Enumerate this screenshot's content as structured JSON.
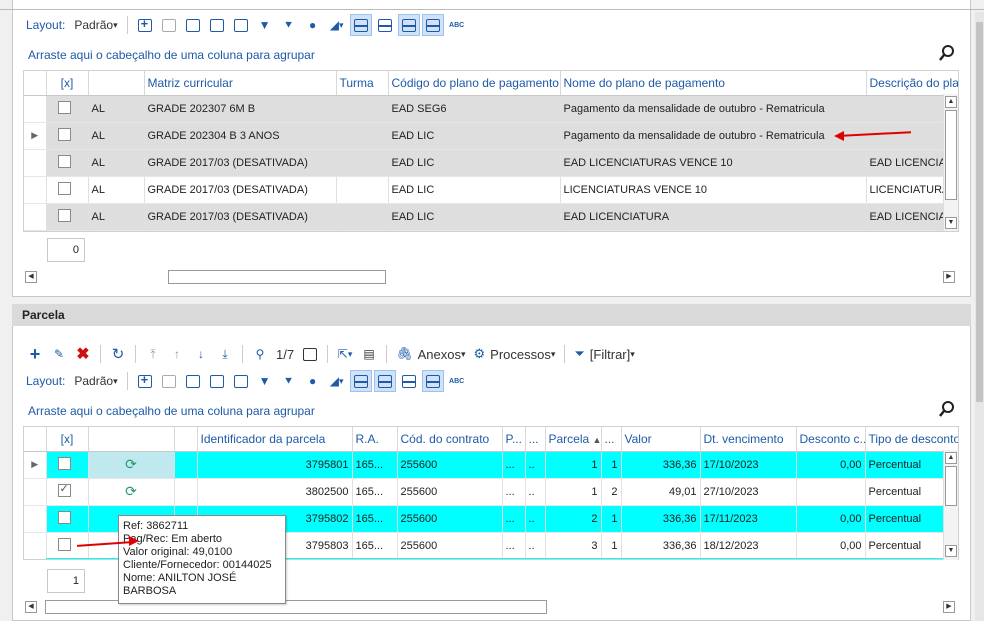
{
  "top_toolbar": {
    "layout_label": "Layout:",
    "layout_value": "Padrão",
    "abc_label": "ABC"
  },
  "top_grid": {
    "group_hint": "Arraste aqui o cabeçalho de uma coluna para agrupar",
    "columns": [
      "[x]",
      "",
      "Matriz curricular",
      "Turma",
      "Código do plano de pagamento",
      "Nome do plano de pagamento",
      "Descrição do plano"
    ],
    "rows": [
      {
        "c1": "AL",
        "matriz": "GRADE 202307 6M B",
        "turma": "",
        "codigo": "EAD SEG6",
        "nome": "Pagamento da mensalidade de outubro - Rematricula",
        "descricao": ""
      },
      {
        "c1": "AL",
        "matriz": "GRADE 202304 B 3 ANOS",
        "turma": "",
        "codigo": "EAD LIC",
        "nome": "Pagamento da mensalidade de outubro - Rematricula",
        "descricao": ""
      },
      {
        "c1": "AL",
        "matriz": "GRADE 2017/03 (DESATIVADA)",
        "turma": "",
        "codigo": "EAD LIC",
        "nome": "EAD LICENCIATURAS VENCE 10",
        "descricao": "EAD LICENCIA"
      },
      {
        "c1": "AL",
        "matriz": "GRADE 2017/03 (DESATIVADA)",
        "turma": "",
        "codigo": "EAD LIC",
        "nome": "LICENCIATURAS VENCE 10",
        "descricao": "LICENCIATURA"
      },
      {
        "c1": "AL",
        "matriz": "GRADE 2017/03 (DESATIVADA)",
        "turma": "",
        "codigo": "EAD LIC",
        "nome": "EAD LICENCIATURA",
        "descricao": "EAD LICENCIA"
      }
    ],
    "count": "0"
  },
  "parcela": {
    "title": "Parcela",
    "page_indicator": "1/7",
    "anexos_label": "Anexos",
    "processos_label": "Processos",
    "filtrar_label": "[Filtrar]",
    "layout_label": "Layout:",
    "layout_value": "Padrão",
    "abc_label": "ABC",
    "group_hint": "Arraste aqui o cabeçalho de uma coluna para agrupar",
    "columns": [
      "[x]",
      "",
      "",
      "Identificador da parcela",
      "R.A.",
      "Cód. do contrato",
      "P...",
      "...",
      "Parcela",
      "...",
      "Valor",
      "Dt. vencimento",
      "Desconto c...",
      "Tipo de desconto"
    ],
    "rows": [
      {
        "checked": false,
        "id": "3795801",
        "ra": "165...",
        "contrato": "255600",
        "p": "...",
        "x": "..",
        "parcela": "1",
        "y": "1",
        "valor": "336,36",
        "venc": "17/10/2023",
        "desconto": "0,00",
        "tipo": "Percentual"
      },
      {
        "checked": true,
        "id": "3802500",
        "ra": "165...",
        "contrato": "255600",
        "p": "...",
        "x": "..",
        "parcela": "1",
        "y": "2",
        "valor": "49,01",
        "venc": "27/10/2023",
        "desconto": "",
        "tipo": "Percentual"
      },
      {
        "checked": false,
        "id": "3795802",
        "ra": "165...",
        "contrato": "255600",
        "p": "...",
        "x": "..",
        "parcela": "2",
        "y": "1",
        "valor": "336,36",
        "venc": "17/11/2023",
        "desconto": "0,00",
        "tipo": "Percentual"
      },
      {
        "checked": false,
        "id": "3795803",
        "ra": "165...",
        "contrato": "255600",
        "p": "...",
        "x": "..",
        "parcela": "3",
        "y": "1",
        "valor": "336,36",
        "venc": "18/12/2023",
        "desconto": "0,00",
        "tipo": "Percentual"
      }
    ],
    "count": "1",
    "tooltip": {
      "ref": "Ref: 3862711",
      "status": "Pag/Rec: Em aberto",
      "valor": "Valor original: 49,0100",
      "cliente": "Cliente/Fornecedor: 00144025",
      "nome": "Nome: ANILTON JOSÉ BARBOSA"
    }
  }
}
